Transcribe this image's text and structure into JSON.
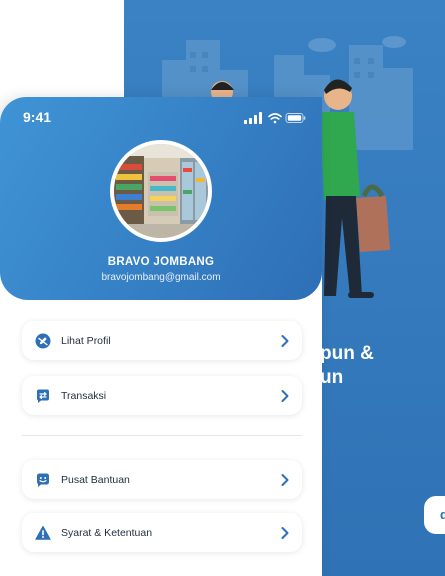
{
  "background_screen": {
    "headline": "pun &\nun",
    "button_label": "d",
    "colors": {
      "bg": "#3a82c4",
      "shirt": "#2fa84f"
    }
  },
  "profile_screen": {
    "status_bar": {
      "time": "9:41",
      "icons": [
        "signal-icon",
        "wifi-icon",
        "battery-icon"
      ]
    },
    "profile": {
      "name": "BRAVO JOMBANG",
      "email": "bravojombang@gmail.com"
    },
    "menu": [
      {
        "label": "Lihat Profil",
        "icon": "edit-profile-icon"
      },
      {
        "label": "Transaksi",
        "icon": "transaction-icon"
      },
      {
        "label": "Pusat Bantuan",
        "icon": "help-center-icon"
      },
      {
        "label": "Syarat & Ketentuan",
        "icon": "warning-icon"
      }
    ],
    "colors": {
      "accent": "#2e6fb6",
      "header_start": "#3f94d6"
    }
  }
}
